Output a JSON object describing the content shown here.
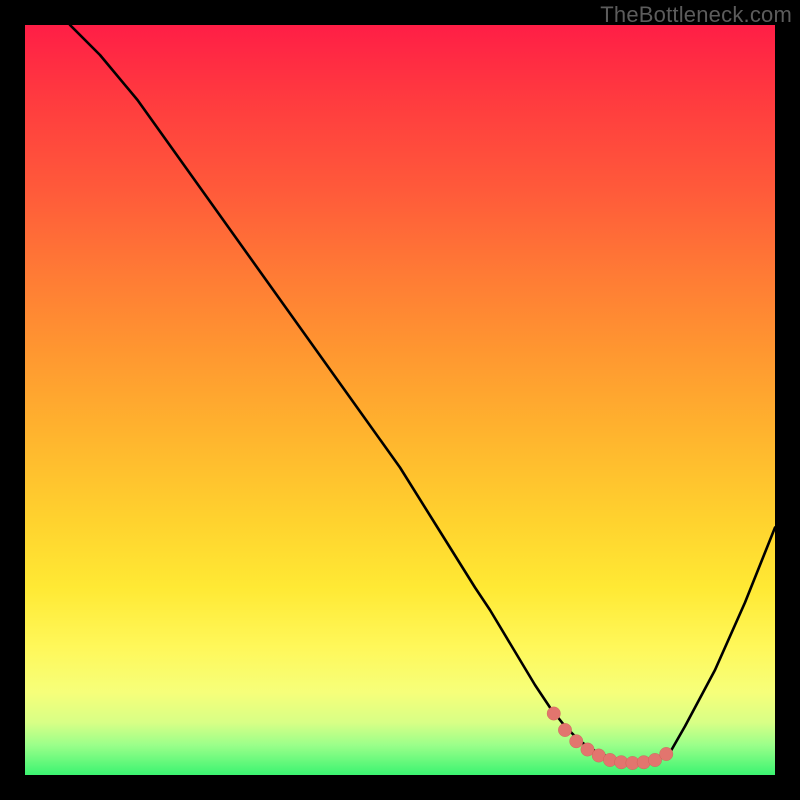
{
  "watermark": "TheBottleneck.com",
  "colors": {
    "background": "#000000",
    "curve_stroke": "#000000",
    "marker_fill": "#e2756e",
    "marker_stroke": "#c14e47",
    "gradient_top": "#ff1e46",
    "gradient_bottom": "#3bf471"
  },
  "chart_data": {
    "type": "line",
    "title": "",
    "xlabel": "",
    "ylabel": "",
    "xlim": [
      0,
      100
    ],
    "ylim": [
      0,
      100
    ],
    "grid": false,
    "legend": false,
    "series": [
      {
        "name": "bottleneck-curve",
        "x": [
          6,
          10,
          15,
          20,
          25,
          30,
          35,
          40,
          45,
          50,
          55,
          60,
          62,
          65,
          68,
          70,
          72,
          74,
          76,
          78,
          80,
          82,
          84,
          86,
          88,
          92,
          96,
          100
        ],
        "y": [
          100,
          96,
          90,
          83,
          76,
          69,
          62,
          55,
          48,
          41,
          33,
          25,
          22,
          17,
          12,
          9,
          6.5,
          4.5,
          3.2,
          2.3,
          1.8,
          1.6,
          1.8,
          3.0,
          6.5,
          14,
          23,
          33
        ]
      }
    ],
    "markers": {
      "name": "optimal-range",
      "x": [
        70.5,
        72,
        73.5,
        75,
        76.5,
        78,
        79.5,
        81,
        82.5,
        84,
        85.5
      ],
      "y": [
        8.2,
        6.0,
        4.5,
        3.4,
        2.6,
        2.0,
        1.7,
        1.6,
        1.7,
        2.0,
        2.8
      ]
    }
  }
}
